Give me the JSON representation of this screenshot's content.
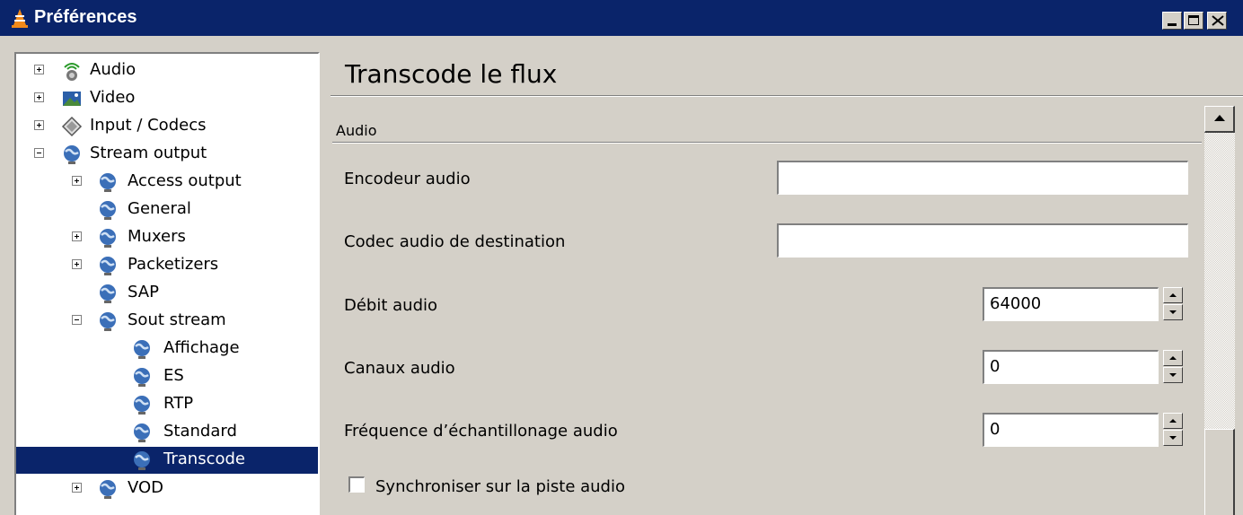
{
  "window": {
    "title": "Préférences",
    "buttons": [
      "minimize",
      "maximize",
      "close"
    ]
  },
  "tree": {
    "items": [
      {
        "label": "Audio",
        "icon": "audio-icon",
        "expander": "plus",
        "level": 0
      },
      {
        "label": "Video",
        "icon": "video-icon",
        "expander": "plus",
        "level": 0
      },
      {
        "label": "Input / Codecs",
        "icon": "codecs-icon",
        "expander": "plus",
        "level": 0
      },
      {
        "label": "Stream output",
        "icon": "globe-icon",
        "expander": "minus",
        "level": 0
      },
      {
        "label": "Access output",
        "icon": "globe-icon",
        "expander": "plus",
        "level": 1
      },
      {
        "label": "General",
        "icon": "globe-icon",
        "expander": "none",
        "level": 1
      },
      {
        "label": "Muxers",
        "icon": "globe-icon",
        "expander": "plus",
        "level": 1
      },
      {
        "label": "Packetizers",
        "icon": "globe-icon",
        "expander": "plus",
        "level": 1
      },
      {
        "label": "SAP",
        "icon": "globe-icon",
        "expander": "none",
        "level": 1
      },
      {
        "label": "Sout stream",
        "icon": "globe-icon",
        "expander": "minus",
        "level": 1
      },
      {
        "label": "Affichage",
        "icon": "globe-icon",
        "expander": "none",
        "level": 2
      },
      {
        "label": "ES",
        "icon": "globe-icon",
        "expander": "none",
        "level": 2
      },
      {
        "label": "RTP",
        "icon": "globe-icon",
        "expander": "none",
        "level": 2
      },
      {
        "label": "Standard",
        "icon": "globe-icon",
        "expander": "none",
        "level": 2
      },
      {
        "label": "Transcode",
        "icon": "globe-icon",
        "expander": "none",
        "level": 2,
        "selected": true
      },
      {
        "label": "VOD",
        "icon": "globe-icon",
        "expander": "plus",
        "level": 1
      }
    ]
  },
  "panel": {
    "title": "Transcode le flux",
    "section": "Audio",
    "fields": {
      "encoder": {
        "label": "Encodeur audio",
        "value": ""
      },
      "codec": {
        "label": "Codec audio de destination",
        "value": ""
      },
      "bitrate": {
        "label": "Débit audio",
        "value": "64000"
      },
      "channels": {
        "label": "Canaux audio",
        "value": "0"
      },
      "samplerate": {
        "label": "Fréquence d’échantillonage audio",
        "value": "0"
      },
      "sync": {
        "label": "Synchroniser sur la piste audio",
        "checked": false
      }
    }
  },
  "colors": {
    "titlebar": "#0a246a",
    "selection": "#0a246a",
    "face": "#d4d0c8"
  }
}
